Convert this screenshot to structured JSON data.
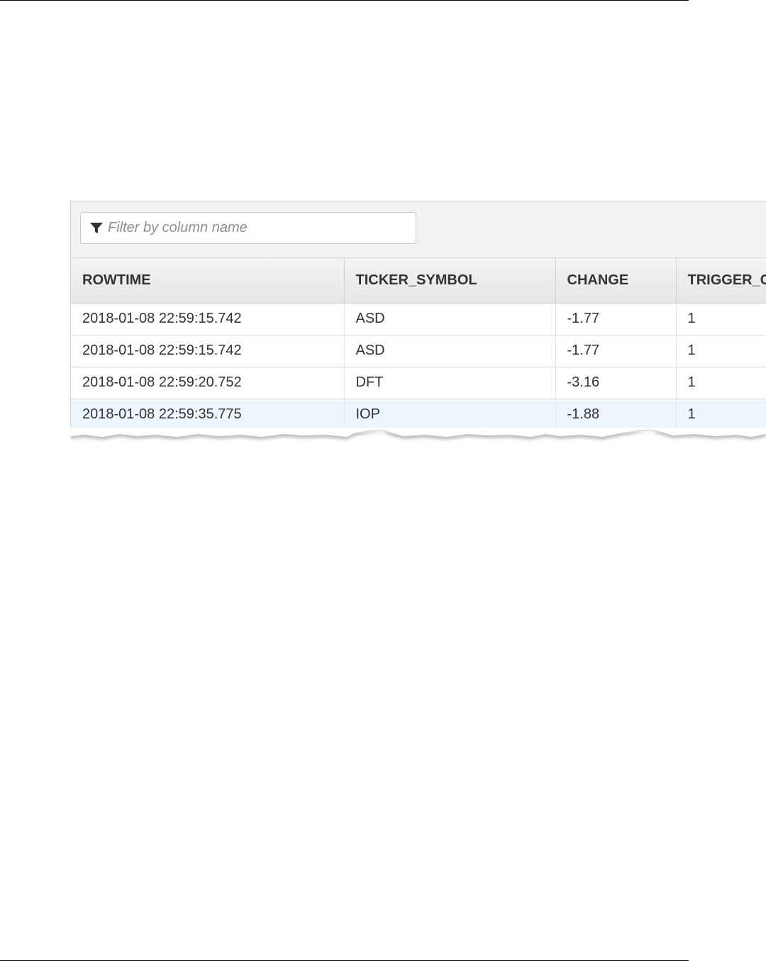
{
  "filter": {
    "placeholder": "Filter by column name",
    "icon": "filter-icon"
  },
  "table": {
    "columns": [
      "ROWTIME",
      "TICKER_SYMBOL",
      "CHANGE",
      "TRIGGER_C"
    ],
    "rows": [
      {
        "rowtime": "2018-01-08 22:59:15.742",
        "ticker_symbol": "ASD",
        "change": "-1.77",
        "trigger": "1"
      },
      {
        "rowtime": "2018-01-08 22:59:15.742",
        "ticker_symbol": "ASD",
        "change": "-1.77",
        "trigger": "1"
      },
      {
        "rowtime": "2018-01-08 22:59:20.752",
        "ticker_symbol": "DFT",
        "change": "-3.16",
        "trigger": "1"
      },
      {
        "rowtime": "2018-01-08 22:59:35.775",
        "ticker_symbol": "IOP",
        "change": "-1.88",
        "trigger": "1"
      }
    ],
    "highlighted_row_index": 3
  },
  "colors": {
    "toolbar_bg": "#f2f2f2",
    "header_bg": "#ececec",
    "highlight_row": "#eef6fd",
    "text": "#333333",
    "placeholder": "#8f8f8f"
  }
}
